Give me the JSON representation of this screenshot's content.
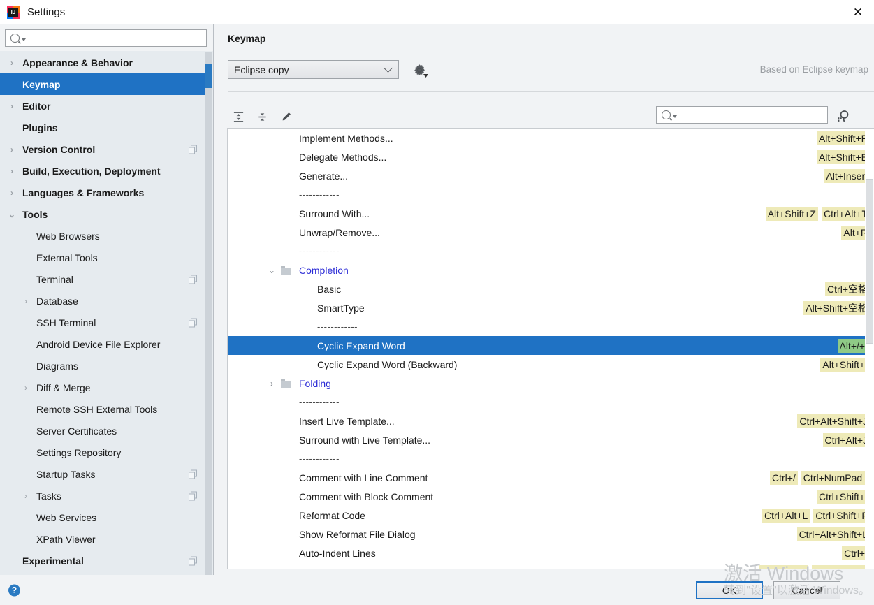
{
  "window": {
    "title": "Settings",
    "app_icon": "intellij-idea-icon",
    "close_icon": "close-icon"
  },
  "sidebar": {
    "search": {
      "placeholder": "",
      "value": "",
      "icon": "search-icon"
    },
    "items": [
      {
        "label": "Appearance & Behavior",
        "level": 0,
        "arrow": "collapsed",
        "selected": false,
        "copy": false
      },
      {
        "label": "Keymap",
        "level": 0,
        "arrow": "none",
        "selected": true,
        "copy": false
      },
      {
        "label": "Editor",
        "level": 0,
        "arrow": "collapsed",
        "selected": false,
        "copy": false
      },
      {
        "label": "Plugins",
        "level": 0,
        "arrow": "none",
        "selected": false,
        "copy": false
      },
      {
        "label": "Version Control",
        "level": 0,
        "arrow": "collapsed",
        "selected": false,
        "copy": true
      },
      {
        "label": "Build, Execution, Deployment",
        "level": 0,
        "arrow": "collapsed",
        "selected": false,
        "copy": false
      },
      {
        "label": "Languages & Frameworks",
        "level": 0,
        "arrow": "collapsed",
        "selected": false,
        "copy": false
      },
      {
        "label": "Tools",
        "level": 0,
        "arrow": "expanded",
        "selected": false,
        "copy": false
      },
      {
        "label": "Web Browsers",
        "level": 1,
        "arrow": "none",
        "selected": false,
        "copy": false
      },
      {
        "label": "External Tools",
        "level": 1,
        "arrow": "none",
        "selected": false,
        "copy": false
      },
      {
        "label": "Terminal",
        "level": 1,
        "arrow": "none",
        "selected": false,
        "copy": true
      },
      {
        "label": "Database",
        "level": 1,
        "arrow": "collapsed",
        "selected": false,
        "copy": false
      },
      {
        "label": "SSH Terminal",
        "level": 1,
        "arrow": "none",
        "selected": false,
        "copy": true
      },
      {
        "label": "Android Device File Explorer",
        "level": 1,
        "arrow": "none",
        "selected": false,
        "copy": false
      },
      {
        "label": "Diagrams",
        "level": 1,
        "arrow": "none",
        "selected": false,
        "copy": false
      },
      {
        "label": "Diff & Merge",
        "level": 1,
        "arrow": "collapsed",
        "selected": false,
        "copy": false
      },
      {
        "label": "Remote SSH External Tools",
        "level": 1,
        "arrow": "none",
        "selected": false,
        "copy": false
      },
      {
        "label": "Server Certificates",
        "level": 1,
        "arrow": "none",
        "selected": false,
        "copy": false
      },
      {
        "label": "Settings Repository",
        "level": 1,
        "arrow": "none",
        "selected": false,
        "copy": false
      },
      {
        "label": "Startup Tasks",
        "level": 1,
        "arrow": "none",
        "selected": false,
        "copy": true
      },
      {
        "label": "Tasks",
        "level": 1,
        "arrow": "collapsed",
        "selected": false,
        "copy": true
      },
      {
        "label": "Web Services",
        "level": 1,
        "arrow": "none",
        "selected": false,
        "copy": false
      },
      {
        "label": "XPath Viewer",
        "level": 1,
        "arrow": "none",
        "selected": false,
        "copy": false
      },
      {
        "label": "Experimental",
        "level": 0,
        "arrow": "none",
        "selected": false,
        "copy": true
      }
    ]
  },
  "panel": {
    "title": "Keymap",
    "keymap_select": {
      "value": "Eclipse copy",
      "caret_icon": "chevron-down-icon"
    },
    "gear_icon": "gear-icon",
    "based_on": "Based on Eclipse keymap",
    "toolbar": {
      "expand_all_icon": "expand-all-icon",
      "collapse_all_icon": "collapse-all-icon",
      "edit_icon": "pencil-edit-icon",
      "filter": {
        "placeholder": "",
        "value": "",
        "icon": "search-icon"
      },
      "find_shortcut_icon": "find-by-shortcut-icon"
    }
  },
  "tree": {
    "rows": [
      {
        "type": "action",
        "label": "Implement Methods...",
        "indent": 102,
        "shortcuts": [
          "Alt+Shift+P"
        ]
      },
      {
        "type": "action",
        "label": "Delegate Methods...",
        "indent": 102,
        "shortcuts": [
          "Alt+Shift+E"
        ]
      },
      {
        "type": "action",
        "label": "Generate...",
        "indent": 102,
        "shortcuts": [
          "Alt+Insert"
        ]
      },
      {
        "type": "separator",
        "label": "------------",
        "indent": 102,
        "shortcuts": []
      },
      {
        "type": "action",
        "label": "Surround With...",
        "indent": 102,
        "shortcuts": [
          "Alt+Shift+Z",
          "Ctrl+Alt+T"
        ]
      },
      {
        "type": "action",
        "label": "Unwrap/Remove...",
        "indent": 102,
        "shortcuts": [
          "Alt+R"
        ]
      },
      {
        "type": "separator",
        "label": "------------",
        "indent": 102,
        "shortcuts": []
      },
      {
        "type": "group",
        "label": "Completion",
        "indent": 102,
        "shortcuts": [],
        "arrow": "expanded",
        "folder": true
      },
      {
        "type": "action",
        "label": "Basic",
        "indent": 128,
        "shortcuts": [
          "Ctrl+空格"
        ]
      },
      {
        "type": "action",
        "label": "SmartType",
        "indent": 128,
        "shortcuts": [
          "Alt+Shift+空格"
        ]
      },
      {
        "type": "separator",
        "label": "------------",
        "indent": 128,
        "shortcuts": []
      },
      {
        "type": "action",
        "label": "Cyclic Expand Word",
        "indent": 128,
        "shortcuts": [
          "Alt+/+/"
        ],
        "selected": true
      },
      {
        "type": "action",
        "label": "Cyclic Expand Word (Backward)",
        "indent": 128,
        "shortcuts": [
          "Alt+Shift+/"
        ]
      },
      {
        "type": "group",
        "label": "Folding",
        "indent": 102,
        "shortcuts": [],
        "arrow": "collapsed",
        "folder": true
      },
      {
        "type": "separator",
        "label": "------------",
        "indent": 102,
        "shortcuts": []
      },
      {
        "type": "action",
        "label": "Insert Live Template...",
        "indent": 102,
        "shortcuts": [
          "Ctrl+Alt+Shift+J"
        ]
      },
      {
        "type": "action",
        "label": "Surround with Live Template...",
        "indent": 102,
        "shortcuts": [
          "Ctrl+Alt+J"
        ]
      },
      {
        "type": "separator",
        "label": "------------",
        "indent": 102,
        "shortcuts": []
      },
      {
        "type": "action",
        "label": "Comment with Line Comment",
        "indent": 102,
        "shortcuts": [
          "Ctrl+/",
          "Ctrl+NumPad /"
        ]
      },
      {
        "type": "action",
        "label": "Comment with Block Comment",
        "indent": 102,
        "shortcuts": [
          "Ctrl+Shift+/"
        ]
      },
      {
        "type": "action",
        "label": "Reformat Code",
        "indent": 102,
        "shortcuts": [
          "Ctrl+Alt+L",
          "Ctrl+Shift+F"
        ]
      },
      {
        "type": "action",
        "label": "Show Reformat File Dialog",
        "indent": 102,
        "shortcuts": [
          "Ctrl+Alt+Shift+L"
        ]
      },
      {
        "type": "action",
        "label": "Auto-Indent Lines",
        "indent": 102,
        "shortcuts": [
          "Ctrl+I"
        ]
      },
      {
        "type": "action",
        "label": "Optimize Imports",
        "indent": 102,
        "shortcuts": [
          "Ctrl+Alt+O",
          "Ctrl+Shift+O"
        ]
      }
    ]
  },
  "bottom": {
    "help_label": "?",
    "ok_label": "OK",
    "cancel_label": "Cancel"
  },
  "watermark": {
    "line1": "激活 Windows",
    "line2": "转到\"设置\"以激活 Windows。"
  },
  "colors": {
    "accent": "#1f72c4",
    "shortcut_badge": "#eeeab8",
    "shortcut_badge_selected": "#8fca86",
    "sidebar_bg": "#e6ebef",
    "panel_bg": "#f1f3f5",
    "group_text": "#2b2bd6"
  }
}
